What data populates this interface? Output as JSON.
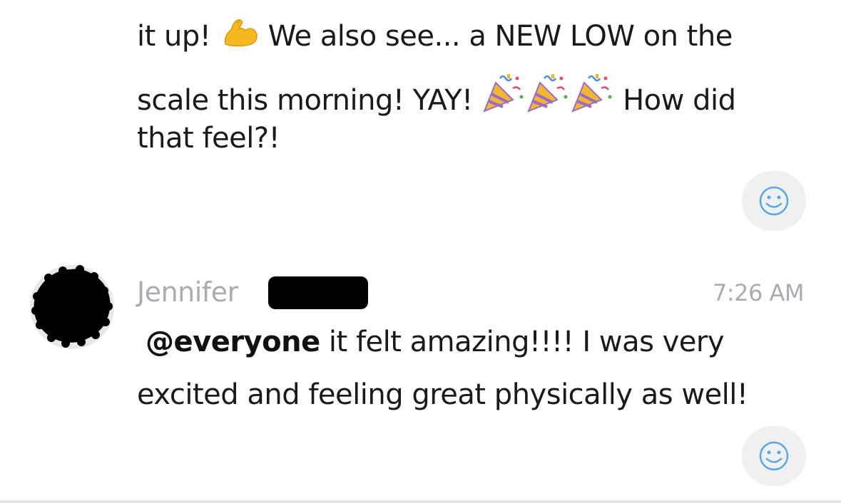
{
  "message_1": {
    "line_1_before": "it up! ",
    "line_1_emoji": "flexed-biceps",
    "line_1_after": " We also see... a NEW LOW on the",
    "line_2_before": "scale this morning! YAY! ",
    "line_2_emojis": [
      "party-popper",
      "party-popper",
      "party-popper"
    ],
    "line_2_after": " How did",
    "line_3": "that feel?!"
  },
  "message_2": {
    "sender_name": "Jennifer",
    "timestamp": "7:26 AM",
    "mention": "@everyone",
    "line_1_after": " it felt amazing!!!! I was very",
    "line_2": "excited and feeling great physically as well!"
  },
  "icons": {
    "reaction": "smiley-icon",
    "avatar": "avatar-redacted",
    "accent_color": "#5aa8e0"
  }
}
